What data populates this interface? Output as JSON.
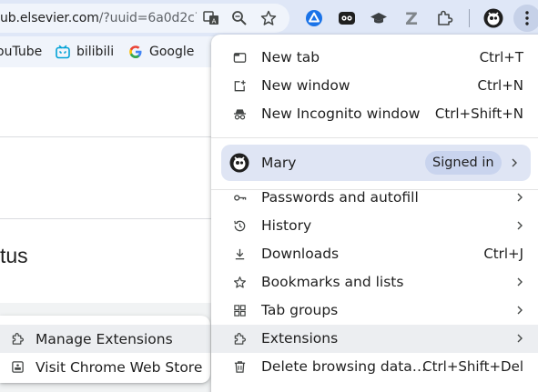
{
  "toolbar": {
    "url_host": "ub.elsevier.com",
    "url_rest": "/?uuid=6a0d2c7…",
    "icons": [
      "translate-icon",
      "zoom-icon",
      "bookmark-star-icon",
      "drive-icon",
      "extension-icon-1",
      "graduation-cap-icon",
      "zotero-icon",
      "puzzle-icon",
      "profile-avatar-icon",
      "kebab-menu-icon"
    ]
  },
  "bookmarks": [
    {
      "label": "ouTube",
      "icon": "youtube-icon"
    },
    {
      "label": "bilibili",
      "icon": "bilibili-icon"
    },
    {
      "label": "Google",
      "icon": "google-icon"
    }
  ],
  "page": {
    "heading": "tus"
  },
  "menu": {
    "items": [
      {
        "label": "New tab",
        "shortcut": "Ctrl+T",
        "icon": "new-tab-icon"
      },
      {
        "label": "New window",
        "shortcut": "Ctrl+N",
        "icon": "new-window-icon"
      },
      {
        "label": "New Incognito window",
        "shortcut": "Ctrl+Shift+N",
        "icon": "incognito-icon"
      }
    ],
    "profile": {
      "name": "Mary",
      "status": "Signed in"
    },
    "items2": [
      {
        "label": "Passwords and autofill",
        "icon": "key-icon"
      },
      {
        "label": "History",
        "icon": "history-icon"
      },
      {
        "label": "Downloads",
        "shortcut": "Ctrl+J",
        "icon": "download-icon"
      },
      {
        "label": "Bookmarks and lists",
        "icon": "star-icon"
      },
      {
        "label": "Tab groups",
        "icon": "tab-groups-icon"
      },
      {
        "label": "Extensions",
        "icon": "extensions-icon"
      },
      {
        "label": "Delete browsing data…",
        "shortcut": "Ctrl+Shift+Del",
        "icon": "trash-icon"
      }
    ]
  },
  "submenu": {
    "items": [
      {
        "label": "Manage Extensions",
        "icon": "extensions-icon"
      },
      {
        "label": "Visit Chrome Web Store",
        "icon": "web-store-icon"
      }
    ]
  },
  "colors": {
    "toolbar_bg": "#dfe7f7",
    "profile_bg": "#dfe5f4",
    "badge_bg": "#c9d4ee",
    "hover_bg": "#eceef1"
  }
}
